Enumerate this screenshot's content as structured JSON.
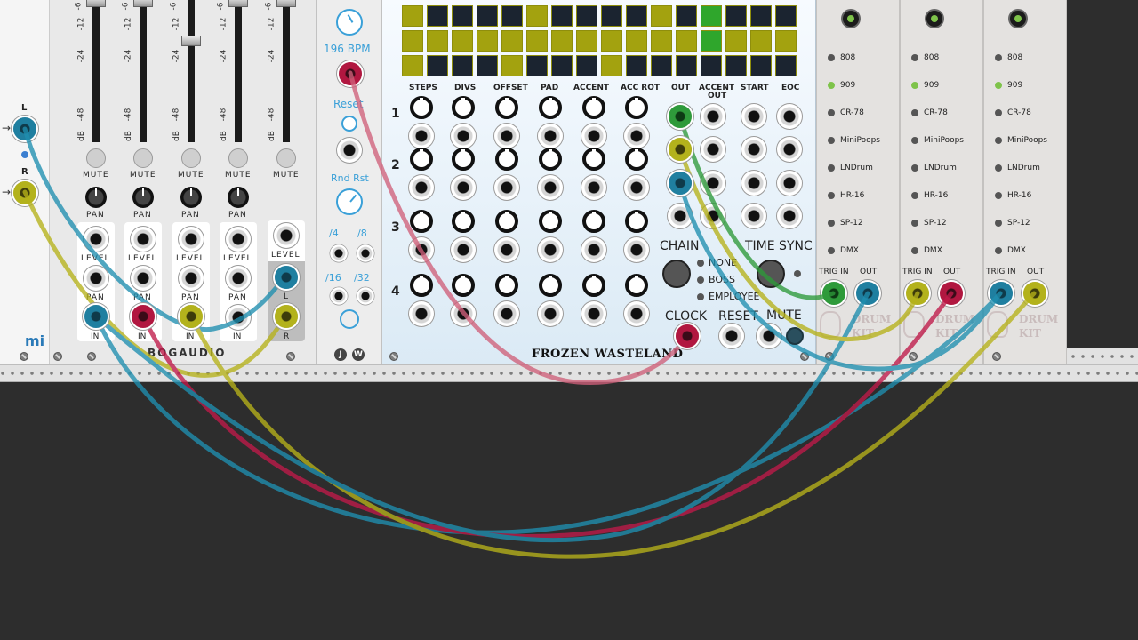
{
  "mi_module": {
    "brand": "mi",
    "left_label": "L",
    "right_label": "R"
  },
  "mixer": {
    "brand": "BOGAUDIO",
    "scale": [
      "-6",
      "-12",
      "-24",
      "-48"
    ],
    "db": "dB",
    "mute": "MUTE",
    "pan": "PAN",
    "level": "LEVEL",
    "in": "IN",
    "out_l": "L",
    "out_r": "R"
  },
  "clock": {
    "bpm": "196 BPM",
    "reset": "Reset",
    "rnd_rst": "Rnd Rst",
    "div4": "/4",
    "div8": "/8",
    "div16": "/16",
    "div32": "/32",
    "logo_j": "J",
    "logo_w": "W"
  },
  "sequencer": {
    "brand": "FROZEN WASTELAND",
    "col_steps": "STEPS",
    "col_divs": "DIVS",
    "col_offset": "OFFSET",
    "col_pad": "PAD",
    "col_accent": "ACCENT",
    "col_accrot": "ACC ROT",
    "col_out": "OUT",
    "col_accentout_1": "ACCENT",
    "col_accentout_2": "OUT",
    "col_start": "START",
    "col_eoc": "EOC",
    "row1": "1",
    "row2": "2",
    "row3": "3",
    "row4": "4",
    "chain": "CHAIN",
    "chain_none": "NONE",
    "chain_boss": "BOSS",
    "chain_employee": "EMPLOYEE",
    "time_sync": "TIME SYNC",
    "clock": "CLOCK",
    "reset": "RESET",
    "mute": "MUTE"
  },
  "drumkit": {
    "kits": [
      "808",
      "909",
      "CR-78",
      "MiniPoops",
      "LNDrum",
      "HR-16",
      "SP-12",
      "DMX"
    ],
    "trig_in": "TRIG IN",
    "out": "OUT",
    "logo_1": "DRUM",
    "logo_2": "KIT",
    "selected": "909"
  },
  "colors": {
    "cable_blue": "#1f8fb0",
    "cable_yellow": "#b6b21a",
    "cable_red": "#c01a4a",
    "cable_green": "#2e9a3a",
    "cable_pink": "#d0607a",
    "seq_cell_on": "#a3a20f",
    "seq_cell_off": "#1b2430",
    "seq_cell_active": "#2fa62c"
  }
}
